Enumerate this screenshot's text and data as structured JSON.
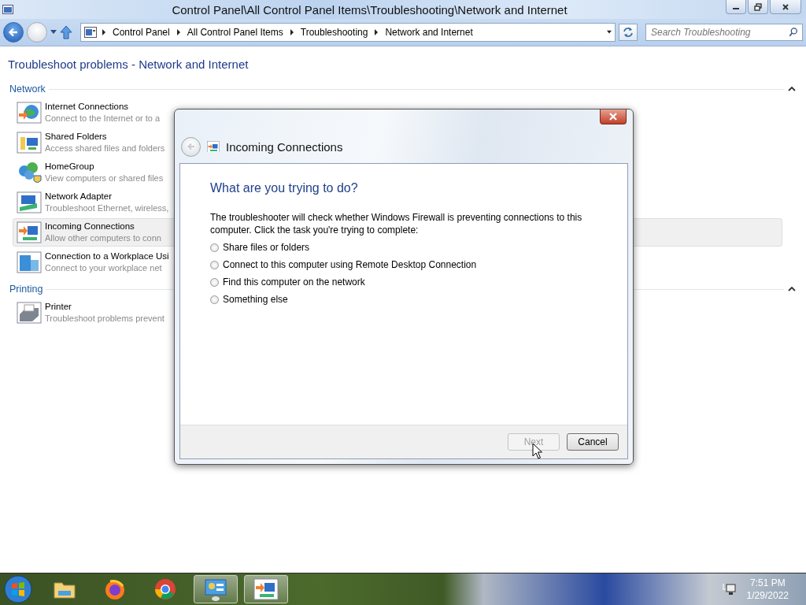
{
  "window": {
    "title": "Control Panel\\All Control Panel Items\\Troubleshooting\\Network and Internet"
  },
  "address_bar": {
    "crumbs": [
      "Control Panel",
      "All Control Panel Items",
      "Troubleshooting",
      "Network and Internet"
    ],
    "search": {
      "placeholder": "Search Troubleshooting"
    }
  },
  "page": {
    "heading": "Troubleshoot problems - Network and Internet",
    "sections": [
      {
        "title": "Network",
        "expanded": true,
        "items": [
          {
            "kind": "globe",
            "title": "Internet Connections",
            "description": "Connect to the Internet or to a",
            "selected": false
          },
          {
            "kind": "folder",
            "title": "Shared Folders",
            "description": "Access shared files and folders",
            "selected": false
          },
          {
            "kind": "homegroup",
            "title": "HomeGroup",
            "description": "View computers or shared files",
            "selected": false
          },
          {
            "kind": "adapter",
            "title": "Network Adapter",
            "description": "Troubleshoot Ethernet, wireless,",
            "selected": false
          },
          {
            "kind": "incoming",
            "title": "Incoming Connections",
            "description": "Allow other computers to conn",
            "selected": true
          },
          {
            "kind": "workplace",
            "title": "Connection to a Workplace Usi",
            "description": "Connect to your workplace net",
            "selected": false
          }
        ]
      },
      {
        "title": "Printing",
        "expanded": true,
        "items": [
          {
            "kind": "printer",
            "title": "Printer",
            "description": "Troubleshoot problems prevent",
            "selected": false
          }
        ]
      }
    ]
  },
  "dialog": {
    "title": "Incoming Connections",
    "question": "What are you trying to do?",
    "intro": "The troubleshooter will check whether Windows Firewall is preventing connections to this computer. Click the task you're trying to complete:",
    "options": [
      {
        "label": "Share files or folders",
        "selected": false
      },
      {
        "label": "Connect to this computer using Remote Desktop Connection",
        "selected": false
      },
      {
        "label": "Find this computer on the network",
        "selected": false
      },
      {
        "label": "Something else",
        "selected": false
      }
    ],
    "buttons": [
      {
        "label": "Next",
        "disabled": true
      },
      {
        "label": "Cancel",
        "disabled": false
      }
    ]
  },
  "taskbar": {
    "apps": [
      {
        "kind": "explorer",
        "active": false
      },
      {
        "kind": "firefox",
        "active": false
      },
      {
        "kind": "chrome",
        "active": false
      },
      {
        "kind": "control-panel",
        "active": true
      },
      {
        "kind": "incoming",
        "active": true
      }
    ],
    "clock": {
      "time": "7:51 PM",
      "date": "1/29/2022"
    }
  }
}
